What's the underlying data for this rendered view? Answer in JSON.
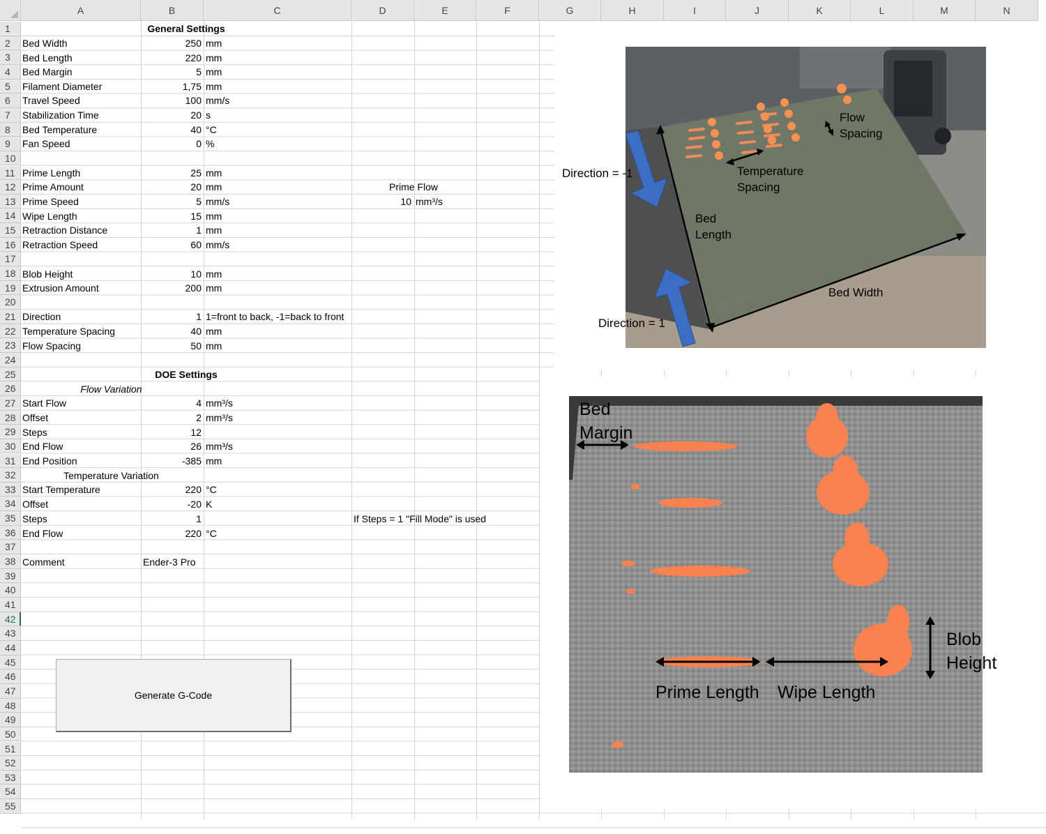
{
  "columns": [
    "A",
    "B",
    "C",
    "D",
    "E",
    "F",
    "G",
    "H",
    "I",
    "J",
    "K",
    "L",
    "M",
    "N"
  ],
  "rows": [
    "1",
    "2",
    "3",
    "4",
    "5",
    "6",
    "7",
    "8",
    "9",
    "10",
    "11",
    "12",
    "13",
    "14",
    "15",
    "16",
    "17",
    "18",
    "19",
    "20",
    "21",
    "22",
    "23",
    "24",
    "25",
    "26",
    "27",
    "28",
    "29",
    "30",
    "31",
    "32",
    "33",
    "34",
    "35",
    "36",
    "37",
    "38",
    "39",
    "40",
    "41",
    "42",
    "43",
    "44",
    "45",
    "46",
    "47",
    "48",
    "49",
    "50",
    "51",
    "52",
    "53",
    "54",
    "55"
  ],
  "selected_row": "42",
  "cells": {
    "general_title": "General Settings",
    "bed_width": {
      "label": "Bed Width",
      "value": "250",
      "unit": "mm"
    },
    "bed_length": {
      "label": "Bed Length",
      "value": "220",
      "unit": "mm"
    },
    "bed_margin": {
      "label": "Bed Margin",
      "value": "5",
      "unit": "mm"
    },
    "filament_diameter": {
      "label": "Filament Diameter",
      "value": "1,75",
      "unit": "mm"
    },
    "travel_speed": {
      "label": "Travel Speed",
      "value": "100",
      "unit": "mm/s"
    },
    "stabilization_time": {
      "label": "Stabilization Time",
      "value": "20",
      "unit": "s"
    },
    "bed_temperature": {
      "label": "Bed Temperature",
      "value": "40",
      "unit": "°C"
    },
    "fan_speed": {
      "label": "Fan Speed",
      "value": "0",
      "unit": "%"
    },
    "prime_length": {
      "label": "Prime Length",
      "value": "25",
      "unit": "mm"
    },
    "prime_amount": {
      "label": "Prime Amount",
      "value": "20",
      "unit": "mm"
    },
    "prime_speed": {
      "label": "Prime Speed",
      "value": "5",
      "unit": "mm/s"
    },
    "wipe_length": {
      "label": "Wipe Length",
      "value": "15",
      "unit": "mm"
    },
    "retraction_distance": {
      "label": "Retraction Distance",
      "value": "1",
      "unit": "mm"
    },
    "retraction_speed": {
      "label": "Retraction Speed",
      "value": "60",
      "unit": "mm/s"
    },
    "blob_height": {
      "label": "Blob Height",
      "value": "10",
      "unit": "mm"
    },
    "extrusion_amount": {
      "label": "Extrusion Amount",
      "value": "200",
      "unit": "mm"
    },
    "direction": {
      "label": "Direction",
      "value": "1",
      "unit": "1=front to back, -1=back to front"
    },
    "temperature_spacing": {
      "label": "Temperature Spacing",
      "value": "40",
      "unit": "mm"
    },
    "flow_spacing": {
      "label": "Flow Spacing",
      "value": "50",
      "unit": "mm"
    },
    "prime_flow_label": "Prime Flow",
    "prime_flow_value": "10",
    "prime_flow_unit": "mm³/s",
    "doe_title": "DOE Settings",
    "flow_variation": "Flow Variation",
    "start_flow": {
      "label": "Start Flow",
      "value": "4",
      "unit": "mm³/s"
    },
    "flow_offset": {
      "label": "Offset",
      "value": "2",
      "unit": "mm³/s"
    },
    "flow_steps": {
      "label": "Steps",
      "value": "12",
      "unit": ""
    },
    "end_flow": {
      "label": "End Flow",
      "value": "26",
      "unit": "mm³/s"
    },
    "end_position": {
      "label": "End Position",
      "value": "-385",
      "unit": "mm"
    },
    "temperature_variation": "Temperature Variation",
    "start_temperature": {
      "label": "Start Temperature",
      "value": "220",
      "unit": "°C"
    },
    "temp_offset": {
      "label": "Offset",
      "value": "-20",
      "unit": "K"
    },
    "temp_steps": {
      "label": "Steps",
      "value": "1",
      "unit": ""
    },
    "fill_mode_note": "If Steps = 1 \"Fill Mode\" is used",
    "temp_end_flow": {
      "label": "End Flow",
      "value": "220",
      "unit": "°C"
    },
    "comment": {
      "label": "Comment",
      "value": "Ender-3 Pro"
    }
  },
  "button": {
    "label": "Generate G-Code"
  },
  "image_top": {
    "flow_spacing": "Flow\nSpacing",
    "flow_spacing_1": "Flow",
    "flow_spacing_2": "Spacing",
    "temp_spacing_1": "Temperature",
    "temp_spacing_2": "Spacing",
    "direction_neg": "Direction = -1",
    "direction_pos": "Direction = 1",
    "bed_length_1": "Bed",
    "bed_length_2": "Length",
    "bed_width": "Bed Width",
    "brand": "FIBERIXX"
  },
  "image_bottom": {
    "bed_margin_1": "Bed",
    "bed_margin_2": "Margin",
    "prime_length": "Prime Length",
    "wipe_length": "Wipe Length",
    "blob_height_1": "Blob",
    "blob_height_2": "Height"
  },
  "colors": {
    "header_bg": "#e6e6e6",
    "grid": "#d4d4d4",
    "select": "#217346",
    "arrow_blue": "#3c6fc4",
    "blob_orange": "#f7814f"
  }
}
